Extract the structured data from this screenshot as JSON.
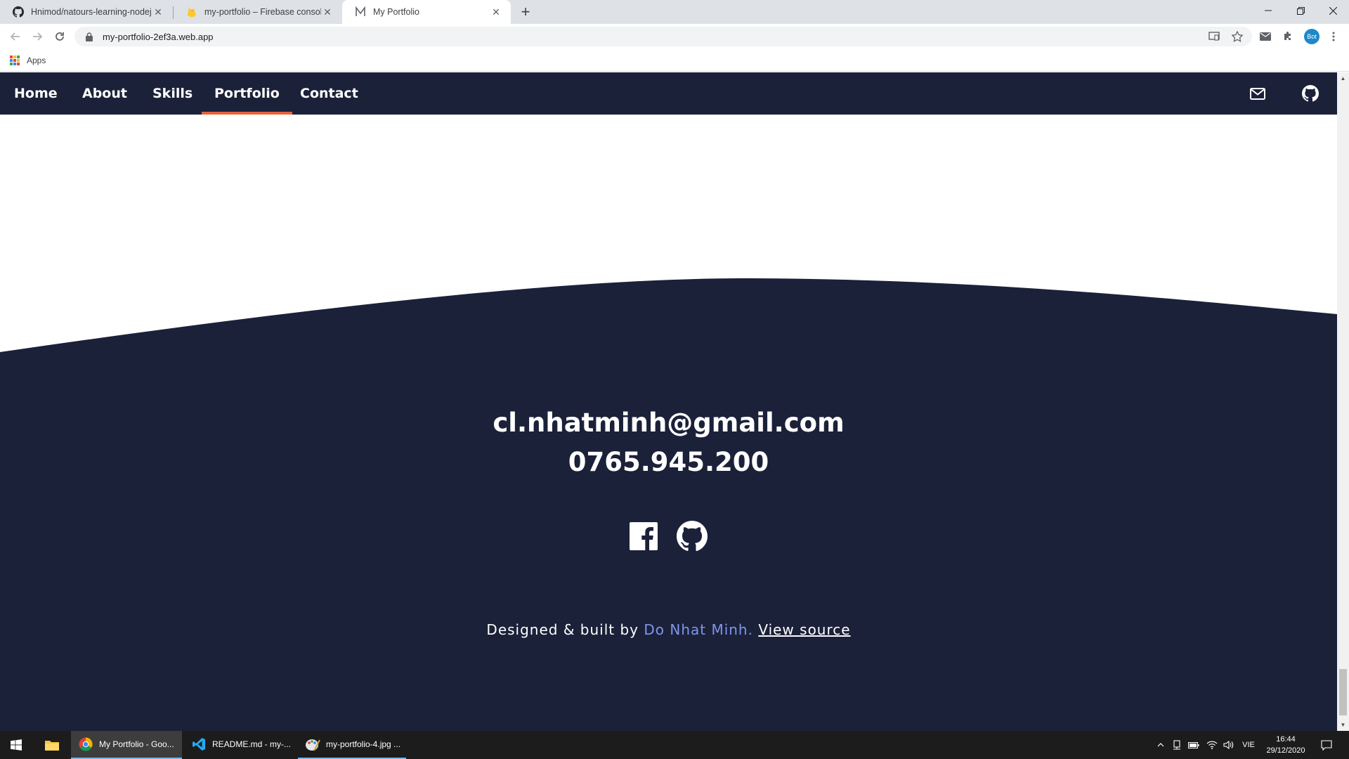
{
  "browser": {
    "tabs": [
      {
        "title": "Hnimod/natours-learning-nodejs",
        "favicon": "github-icon"
      },
      {
        "title": "my-portfolio – Firebase console",
        "favicon": "firebase-icon"
      },
      {
        "title": "My Portfolio",
        "favicon": "portfolio-m-icon",
        "active": true
      }
    ],
    "url": "my-portfolio-2ef3a.web.app",
    "bookmarks_apps_label": "Apps",
    "profile_initials": "Bot"
  },
  "navbar": {
    "items": [
      "Home",
      "About",
      "Skills",
      "Portfolio",
      "Contact"
    ],
    "active_item": "Portfolio",
    "right_icons": [
      "mail-icon",
      "github-icon"
    ]
  },
  "footer": {
    "email": "cl.nhatminh@gmail.com",
    "phone": "0765.945.200",
    "social_icons": [
      "facebook-icon",
      "github-icon"
    ],
    "credit_prefix": "Designed & built by",
    "credit_author": "Do Nhat Minh.",
    "credit_link": "View source"
  },
  "taskbar": {
    "apps": [
      {
        "label": "My Portfolio - Goo...",
        "icon": "chrome-icon"
      },
      {
        "label": "README.md - my-...",
        "icon": "vscode-icon"
      },
      {
        "label": "my-portfolio-4.jpg ...",
        "icon": "paint-icon"
      }
    ],
    "language": "VIE",
    "time": "16:44",
    "date": "29/12/2020"
  },
  "colors": {
    "navy": "#1b2139",
    "accent": "#e8633c",
    "link_blue": "#7f96ea"
  }
}
